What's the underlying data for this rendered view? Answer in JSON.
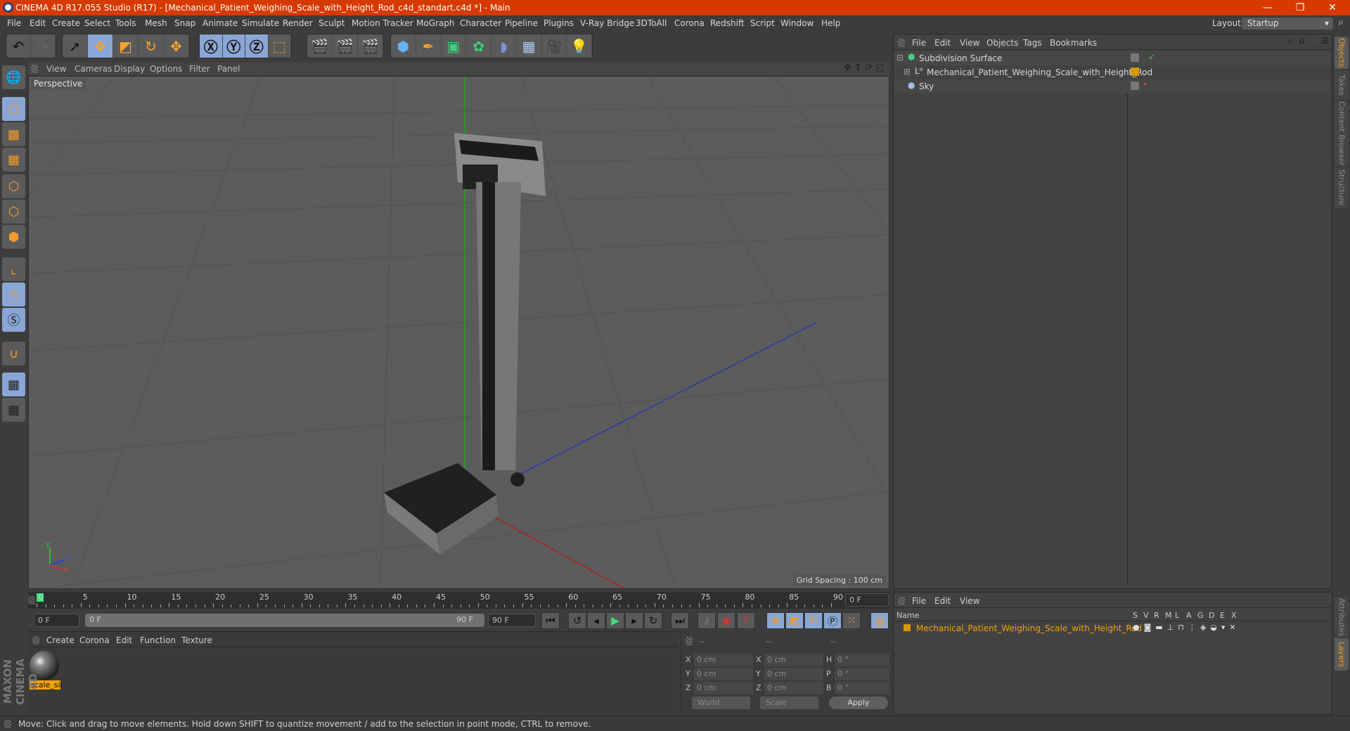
{
  "window": {
    "title": "CINEMA 4D R17.055 Studio (R17) - [Mechanical_Patient_Weighing_Scale_with_Height_Rod_c4d_standart.c4d *] - Main",
    "minimize": "—",
    "restore": "❐",
    "close": "✕"
  },
  "menubar": [
    "File",
    "Edit",
    "Create",
    "Select",
    "Tools",
    "Mesh",
    "Snap",
    "Animate",
    "Simulate",
    "Render",
    "Sculpt",
    "Motion Tracker",
    "MoGraph",
    "Character",
    "Pipeline",
    "Plugins",
    "V-Ray Bridge",
    "3DToAll",
    "Corona",
    "Redshift",
    "Script",
    "Window",
    "Help"
  ],
  "layout": {
    "label": "Layout:",
    "value": "Startup"
  },
  "toolbar": {
    "groups": [
      [
        "undo-icon",
        "redo-icon"
      ],
      [
        "select-icon",
        "move-icon",
        "scale-icon",
        "rotate-icon",
        "move-last-icon"
      ],
      [
        "x-axis-icon",
        "y-axis-icon",
        "z-axis-icon",
        "world-coord-icon"
      ],
      [
        "render-view-icon",
        "render-picture-icon",
        "render-settings-icon"
      ],
      [
        "cube-icon",
        "pen-spline-icon",
        "subdivision-icon",
        "cloner-icon",
        "deformer-icon",
        "floor-icon",
        "camera-icon",
        "light-icon"
      ]
    ]
  },
  "viewport": {
    "menu": [
      "View",
      "Cameras",
      "Display",
      "Options",
      "Filter",
      "Panel"
    ],
    "label": "Perspective",
    "grid_spacing": "Grid Spacing : 100 cm",
    "axis": {
      "x": "X",
      "y": "Y",
      "z": "Z"
    }
  },
  "timeline": {
    "ticks": [
      "0",
      "5",
      "10",
      "15",
      "20",
      "25",
      "30",
      "35",
      "40",
      "45",
      "50",
      "55",
      "60",
      "65",
      "70",
      "75",
      "80",
      "85",
      "90"
    ],
    "current_frame": "0 F",
    "start": "0 F",
    "range_start": "0 F",
    "range_end": "90 F",
    "end": "90 F"
  },
  "objects_panel": {
    "menu": [
      "File",
      "Edit",
      "View",
      "Objects",
      "Tags",
      "Bookmarks"
    ],
    "items": [
      {
        "name": "Subdivision Surface",
        "level": 0
      },
      {
        "name": "Mechanical_Patient_Weighing_Scale_with_Height_Rod",
        "level": 1
      },
      {
        "name": "Sky",
        "level": 0
      }
    ]
  },
  "side_tabs": [
    "Objects",
    "Takes",
    "Content Browser",
    "Structure"
  ],
  "side_tabs_bottom": [
    "Attributes",
    "Layers"
  ],
  "layers_panel": {
    "menu": [
      "File",
      "Edit",
      "View"
    ],
    "columns": [
      "Name",
      "S",
      "V",
      "R",
      "M",
      "L",
      "A",
      "G",
      "D",
      "E",
      "X"
    ],
    "rows": [
      {
        "name": "Mechanical_Patient_Weighing_Scale_with_Height_Rod",
        "color": "#d4960a"
      }
    ]
  },
  "material_panel": {
    "menu": [
      "Create",
      "Corona",
      "Edit",
      "Function",
      "Texture"
    ],
    "materials": [
      {
        "name": "scale_sil"
      }
    ]
  },
  "coordinates": {
    "headers": [
      "--",
      "--",
      "--"
    ],
    "rows": [
      {
        "l1": "X",
        "v1": "0 cm",
        "l2": "X",
        "v2": "0 cm",
        "l3": "H",
        "v3": "0 °"
      },
      {
        "l1": "Y",
        "v1": "0 cm",
        "l2": "Y",
        "v2": "0 cm",
        "l3": "P",
        "v3": "0 °"
      },
      {
        "l1": "Z",
        "v1": "0 cm",
        "l2": "Z",
        "v2": "0 cm",
        "l3": "B",
        "v3": "0 °"
      }
    ],
    "mode": "World",
    "type": "Scale",
    "apply": "Apply"
  },
  "brand": "MAXON CINEMA 4D",
  "status": "Move: Click and drag to move elements. Hold down SHIFT to quantize movement / add to the selection in point mode, CTRL to remove."
}
